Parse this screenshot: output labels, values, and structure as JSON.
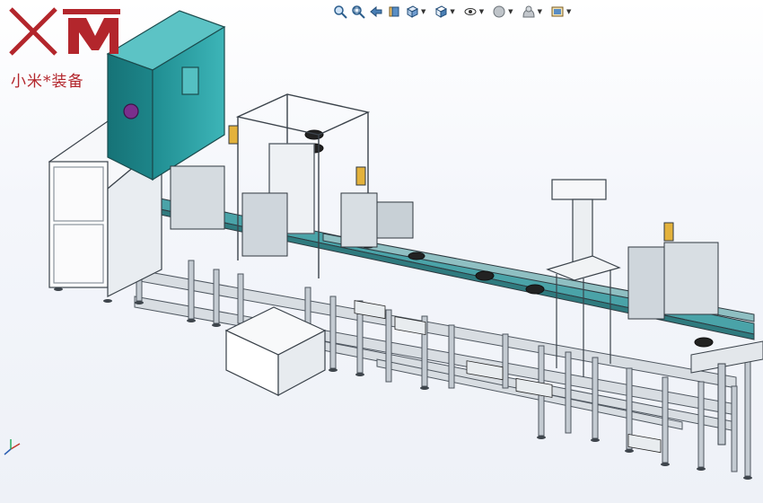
{
  "watermark": {
    "logo_letters": "XM",
    "brand_text": "小米*装备",
    "color": "#b3262c"
  },
  "toolbar": {
    "items": [
      {
        "name": "zoom-to-fit",
        "icon": "zoom-fit-icon"
      },
      {
        "name": "zoom-to-area",
        "icon": "zoom-area-icon"
      },
      {
        "name": "previous-view",
        "icon": "previous-view-icon"
      },
      {
        "name": "section-view",
        "icon": "section-view-icon"
      },
      {
        "name": "view-orientation",
        "icon": "view-orientation-icon",
        "dropdown": true
      },
      {
        "name": "display-style",
        "icon": "display-style-icon",
        "dropdown": true
      },
      {
        "name": "hide-show-items",
        "icon": "hide-show-icon",
        "dropdown": true
      },
      {
        "name": "edit-appearance",
        "icon": "edit-appearance-icon",
        "dropdown": true
      },
      {
        "name": "apply-scene",
        "icon": "apply-scene-icon",
        "dropdown": true
      },
      {
        "name": "view-settings",
        "icon": "view-settings-icon",
        "dropdown": true
      }
    ]
  },
  "colors": {
    "cabinet": "#2ea3a6",
    "frame": "#9aa3ad",
    "frame_dark": "#4f5760",
    "conveyor": "#4aa3a8",
    "panel": "#ffffff"
  }
}
